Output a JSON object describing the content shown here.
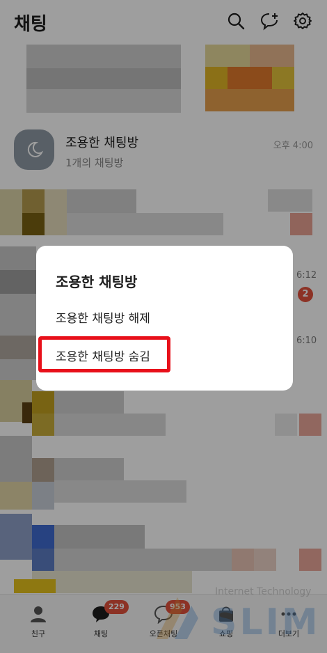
{
  "header": {
    "title": "채팅",
    "icons": [
      "search-icon",
      "new-chat-icon",
      "settings-icon"
    ]
  },
  "quiet_room": {
    "name": "조용한 채팅방",
    "subtitle": "1개의 채팅방",
    "time": "오후 4:00",
    "icon": "moon-icon"
  },
  "background_rows": {
    "time_1": "6:12",
    "badge_1": "2",
    "time_2": "6:10"
  },
  "dialog": {
    "title": "조용한 채팅방",
    "options": [
      {
        "label": "조용한 채팅방 해제"
      },
      {
        "label": "조용한 채팅방 숨김"
      }
    ],
    "highlight_color": "#e8101a"
  },
  "bottom_nav": {
    "items": [
      {
        "label": "친구",
        "icon": "person-icon"
      },
      {
        "label": "채팅",
        "icon": "chat-bubble-icon",
        "badge": "229"
      },
      {
        "label": "오픈채팅",
        "icon": "open-chat-icon",
        "badge": "953"
      },
      {
        "label": "쇼핑",
        "icon": "shopping-bag-icon"
      },
      {
        "label": "더보기",
        "icon": "more-icon"
      }
    ]
  },
  "watermark": {
    "text": "SLIM",
    "subtext": "Internet Technology"
  },
  "colors": {
    "badge": "#e2513d",
    "accent_red": "#e8101a",
    "avatar_gray": "#8e9aa5"
  }
}
